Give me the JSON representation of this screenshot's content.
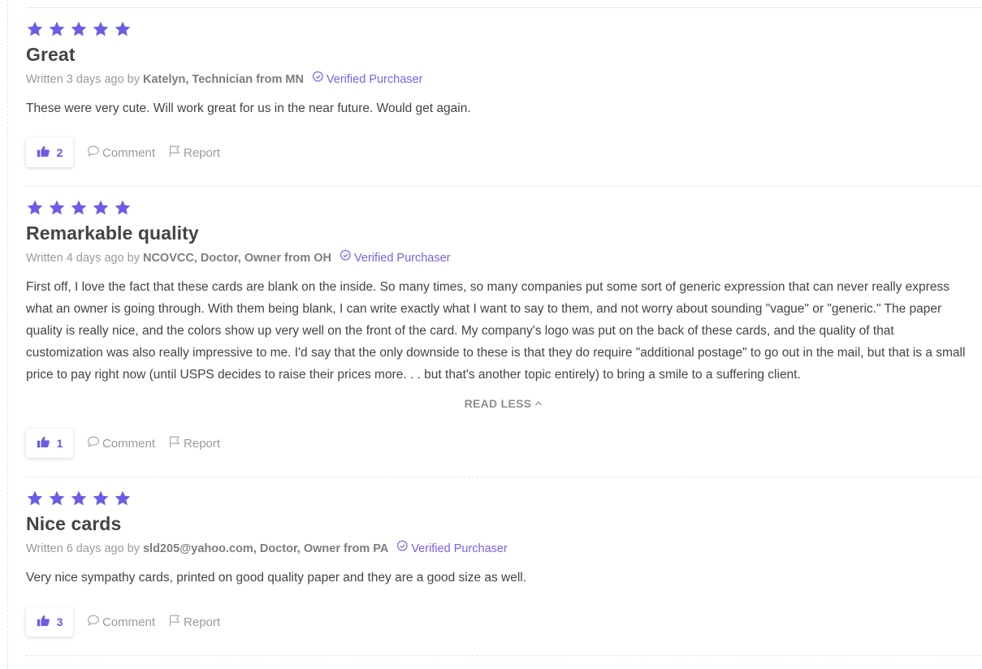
{
  "colors": {
    "star": "#6b5ce7",
    "accent": "#7b61e8",
    "text": "#444444",
    "muted": "#9a9a9a"
  },
  "icons": {
    "star": "star-icon",
    "verified": "check-badge-icon",
    "like": "thumbs-up-icon",
    "comment": "speech-bubble-icon",
    "report": "flag-icon",
    "read_less": "chevron-up-icon"
  },
  "reviews": [
    {
      "rating": 5,
      "title": "Great",
      "written": "Written 3 days ago by",
      "author": "Katelyn, Technician from MN",
      "verified": "Verified Purchaser",
      "body": "These were very cute. Will work great for us in the near future. Would get again.",
      "likes": "2",
      "comment_label": "Comment",
      "report_label": "Report"
    },
    {
      "rating": 5,
      "title": "Remarkable quality",
      "written": "Written 4 days ago by",
      "author": "NCOVCC, Doctor, Owner from OH",
      "verified": "Verified Purchaser",
      "body": "First off, I love the fact that these cards are blank on the inside. So many times, so many companies put some sort of generic expression that can never really express what an owner is going through. With them being blank, I can write exactly what I want to say to them, and not worry about sounding \"vague\" or \"generic.\" The paper quality is really nice, and the colors show up very well on the front of the card. My company's logo was put on the back of these cards, and the quality of that customization was also really impressive to me. I'd say that the only downside to these is that they do require \"additional postage\" to go out in the mail, but that is a small price to pay right now (until USPS decides to raise their prices more. . . but that's another topic entirely) to bring a smile to a suffering client.",
      "read_less": "READ LESS",
      "likes": "1",
      "comment_label": "Comment",
      "report_label": "Report"
    },
    {
      "rating": 5,
      "title": "Nice cards",
      "written": "Written 6 days ago by",
      "author": "sld205@yahoo.com, Doctor, Owner from PA",
      "verified": "Verified Purchaser",
      "body": "Very nice sympathy cards, printed on good quality paper and they are a good size as well.",
      "likes": "3",
      "comment_label": "Comment",
      "report_label": "Report"
    }
  ]
}
